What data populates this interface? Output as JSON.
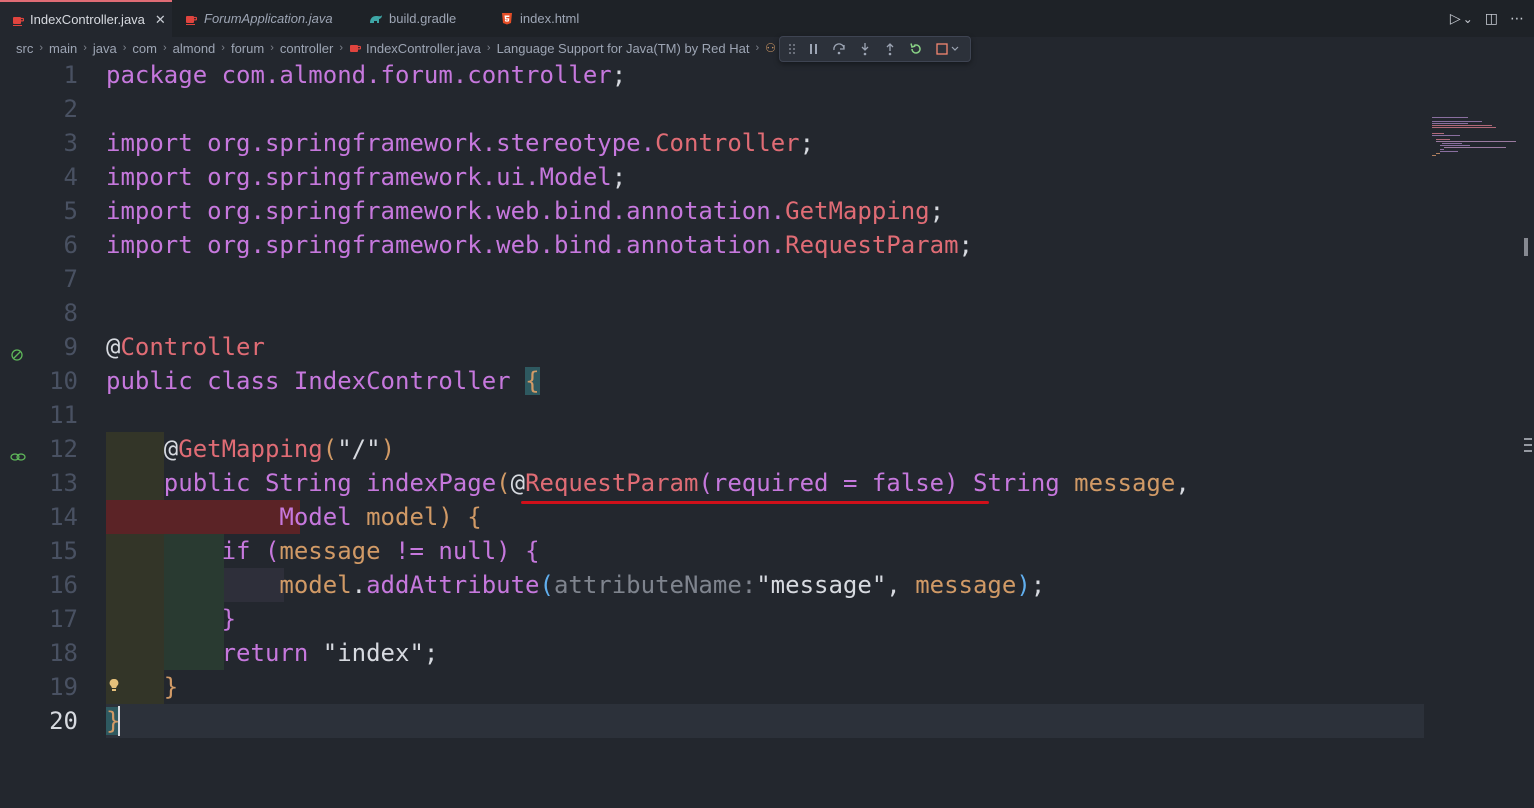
{
  "tabs": [
    {
      "label": "IndexController.java",
      "icon": "java-icon",
      "active": true,
      "close": "✕"
    },
    {
      "label": "ForumApplication.java",
      "icon": "java-icon",
      "active": false
    },
    {
      "label": "build.gradle",
      "icon": "gradle-icon",
      "active": false
    },
    {
      "label": "index.html",
      "icon": "html5-icon",
      "active": false
    }
  ],
  "tab_actions": {
    "run": "▷",
    "run_dropdown": "⌄",
    "split": "◫",
    "more": "⋯"
  },
  "breadcrumb": [
    "src",
    "main",
    "java",
    "com",
    "almond",
    "forum",
    "controller",
    "IndexController.java",
    "Language Support for Java(TM) by Red Hat"
  ],
  "breadcrumb_sep": "›",
  "debug_toolbar": [
    "drag-handle",
    "pause",
    "step-over",
    "step-into",
    "step-out",
    "restart",
    "stop"
  ],
  "line_numbers": [
    "1",
    "2",
    "3",
    "4",
    "5",
    "6",
    "7",
    "8",
    "9",
    "10",
    "11",
    "12",
    "13",
    "14",
    "15",
    "16",
    "17",
    "18",
    "19",
    "20"
  ],
  "current_line": "20",
  "code": {
    "l1": {
      "kw": "package",
      "pkg": "com.almond.forum.controller",
      "end": ";"
    },
    "l3": {
      "kw": "import",
      "pkg": "org.springframework.stereotype.",
      "cls": "Controller",
      "end": ";"
    },
    "l4": {
      "kw": "import",
      "pkg": "org.springframework.ui.",
      "cls": "Model",
      "end": ";"
    },
    "l5": {
      "kw": "import",
      "pkg": "org.springframework.web.bind.annotation.",
      "cls": "GetMapping",
      "end": ";"
    },
    "l6": {
      "kw": "import",
      "pkg": "org.springframework.web.bind.annotation.",
      "cls": "RequestParam",
      "end": ";"
    },
    "l9": {
      "at": "@",
      "ann": "Controller"
    },
    "l10": {
      "kw1": "public",
      "kw2": "class",
      "cls": "IndexController",
      "brace": "{"
    },
    "l12": {
      "at": "@",
      "ann": "GetMapping",
      "open": "(",
      "str": "\"/\"",
      "close": ")"
    },
    "l13": {
      "kw": "public",
      "type": "String",
      "fn": "indexPage",
      "open": "(",
      "at": "@",
      "ann": "RequestParam",
      "aopen": "(",
      "param": "required",
      "eq": "=",
      "val": "false",
      "aclose": ")",
      "type2": "String",
      "var": "message",
      "comma": ","
    },
    "l14": {
      "type": "Model",
      "var": "model",
      "close": ")",
      "brace": "{"
    },
    "l15": {
      "kw": "if",
      "open": "(",
      "var": "message",
      "op": "!=",
      "val": "null",
      "close": ")",
      "brace": "{"
    },
    "l16": {
      "obj": "model",
      "dot": ".",
      "fn": "addAttribute",
      "open": "(",
      "hint": "attributeName:",
      "str": "\"message\"",
      "comma": ",",
      "var": "message",
      "close": ")",
      "end": ";"
    },
    "l17": {
      "brace": "}"
    },
    "l18": {
      "kw": "return",
      "str": "\"index\"",
      "end": ";"
    },
    "l19": {
      "brace": "}"
    },
    "l20": {
      "brace": "}"
    }
  },
  "colors": {
    "keyword": "#c678dd",
    "class": "#e5c07b",
    "annotation": "#e06c75",
    "function": "#61afef",
    "error_underline": "#d0101a",
    "background": "#23272e"
  }
}
